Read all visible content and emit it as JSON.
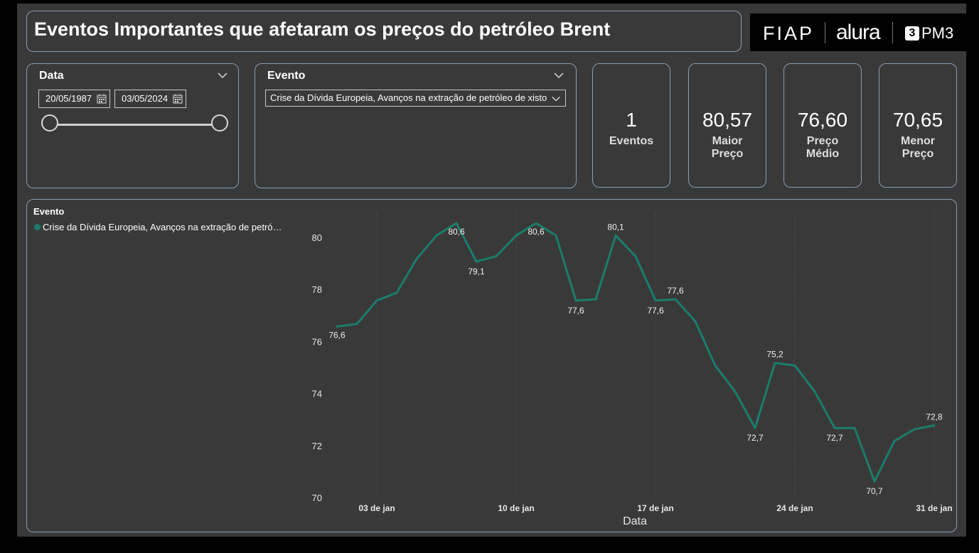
{
  "header": {
    "title": "Eventos Importantes que afetaram os preços do petróleo Brent"
  },
  "logos": {
    "fiap": "FIAP",
    "alura": "alura",
    "pm3": "PM3",
    "pm3_mark": "3"
  },
  "filters": {
    "date": {
      "title": "Data",
      "start": "20/05/1987",
      "end": "03/05/2024"
    },
    "event": {
      "title": "Evento",
      "selected": "Crise da Dívida Europeia, Avanços na extração de petróleo de xisto"
    }
  },
  "kpis": [
    {
      "value": "1",
      "label": "Eventos"
    },
    {
      "value": "80,57",
      "label": "Maior Preço"
    },
    {
      "value": "76,60",
      "label": "Preço Médio"
    },
    {
      "value": "70,65",
      "label": "Menor Preço"
    }
  ],
  "chart_data": {
    "type": "line",
    "legend_title": "Evento",
    "series_name": "Crise da Dívida Europeia, Avanços na extração de petró…",
    "xlabel": "Data",
    "x_ticks": [
      "03 de jan",
      "10 de jan",
      "17 de jan",
      "24 de jan",
      "31 de jan"
    ],
    "y_ticks": [
      "80",
      "78",
      "76",
      "74",
      "72",
      "70"
    ],
    "ylim": [
      70,
      81
    ],
    "x": [
      1,
      2,
      3,
      4,
      5,
      6,
      7,
      8,
      9,
      10,
      11,
      12,
      13,
      14,
      15,
      16,
      17,
      18,
      19,
      20,
      21,
      22,
      23,
      24,
      25,
      26,
      27,
      28,
      29,
      30,
      31
    ],
    "values": [
      76.6,
      76.7,
      77.6,
      77.9,
      79.2,
      80.1,
      80.57,
      79.1,
      79.3,
      80.1,
      80.57,
      80.1,
      77.6,
      77.65,
      80.1,
      79.3,
      77.6,
      77.65,
      76.8,
      75.1,
      74.1,
      72.7,
      75.2,
      75.1,
      74.1,
      72.7,
      72.7,
      70.65,
      72.2,
      72.65,
      72.8
    ],
    "color": "#1c7d6d",
    "data_labels": [
      {
        "x": 1,
        "text": "76,6"
      },
      {
        "x": 7,
        "text": "80,6"
      },
      {
        "x": 8,
        "text": "79,1"
      },
      {
        "x": 11,
        "text": "80,6"
      },
      {
        "x": 13,
        "text": "77,6"
      },
      {
        "x": 15,
        "text": "80,1"
      },
      {
        "x": 17,
        "text": "77,6"
      },
      {
        "x": 18,
        "text": "77,6"
      },
      {
        "x": 22,
        "text": "72,7"
      },
      {
        "x": 23,
        "text": "75,2"
      },
      {
        "x": 26,
        "text": "72,7"
      },
      {
        "x": 28,
        "text": "70,7"
      },
      {
        "x": 31,
        "text": "72,8"
      }
    ]
  }
}
